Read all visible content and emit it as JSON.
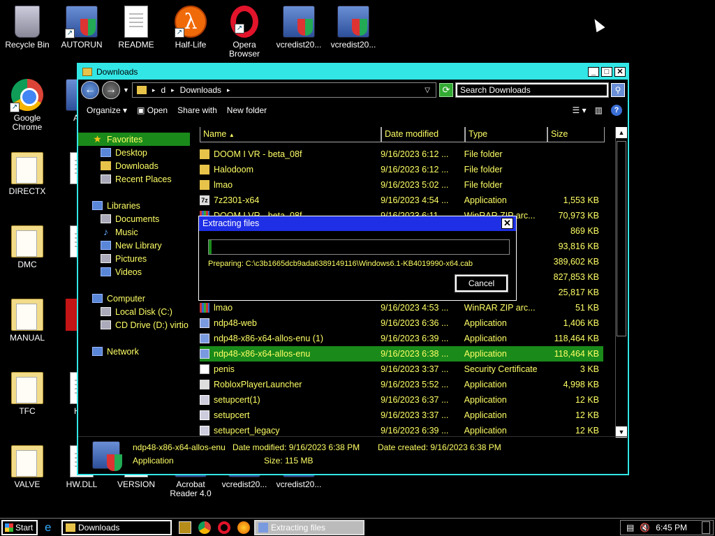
{
  "desktop": {
    "icons": [
      {
        "label": "Recycle Bin",
        "icon": "recycle-bin-icon"
      },
      {
        "label": "AUTORUN",
        "icon": "autorun-installer-icon"
      },
      {
        "label": "README",
        "icon": "text-file-icon"
      },
      {
        "label": "Half-Life",
        "icon": "half-life-icon"
      },
      {
        "label": "Opera Browser",
        "icon": "opera-icon"
      },
      {
        "label": "vcredist20...",
        "icon": "vcredist-installer-icon"
      },
      {
        "label": "vcredist20...",
        "icon": "vcredist-installer-icon"
      },
      {
        "label": "Google Chrome",
        "icon": "chrome-icon"
      },
      {
        "label": "AUT",
        "icon": "installer-icon"
      },
      {
        "label": "DIRECTX",
        "icon": "folder-icon"
      },
      {
        "label": "E",
        "icon": "file-icon"
      },
      {
        "label": "DMC",
        "icon": "folder-icon"
      },
      {
        "label": "HL",
        "icon": "file-icon"
      },
      {
        "label": "MANUAL",
        "icon": "folder-icon"
      },
      {
        "label": "TFC",
        "icon": "folder-icon"
      },
      {
        "label": "HL_",
        "icon": "file-icon"
      },
      {
        "label": "VALVE",
        "icon": "folder-icon"
      },
      {
        "label": "HW.DLL",
        "icon": "file-icon"
      },
      {
        "label": "VERSION",
        "icon": "text-file-icon"
      },
      {
        "label": "Acrobat Reader 4.0",
        "icon": "acrobat-icon"
      },
      {
        "label": "vcredist20...",
        "icon": "vcredist-installer-icon"
      },
      {
        "label": "vcredist20...",
        "icon": "vcredist-installer-icon"
      }
    ]
  },
  "explorer": {
    "title": "Downloads",
    "breadcrumb": [
      "d",
      "Downloads"
    ],
    "search_placeholder": "Search Downloads",
    "toolbar": {
      "organize": "Organize",
      "open": "Open",
      "share_with": "Share with",
      "new_folder": "New folder"
    },
    "nav": {
      "favorites": "Favorites",
      "desktop": "Desktop",
      "downloads": "Downloads",
      "recent": "Recent Places",
      "libraries": "Libraries",
      "documents": "Documents",
      "music": "Music",
      "new_library": "New Library",
      "pictures": "Pictures",
      "videos": "Videos",
      "computer": "Computer",
      "local_disk": "Local Disk (C:)",
      "cd_drive": "CD Drive (D:) virtio",
      "network": "Network"
    },
    "columns": {
      "name": "Name",
      "date": "Date modified",
      "type": "Type",
      "size": "Size"
    },
    "files": [
      {
        "name": "DOOM I VR - beta_08f",
        "date": "9/16/2023 6:12 ...",
        "type": "File folder",
        "size": ""
      },
      {
        "name": "Halodoom",
        "date": "9/16/2023 6:12 ...",
        "type": "File folder",
        "size": ""
      },
      {
        "name": "lmao",
        "date": "9/16/2023 5:02 ...",
        "type": "File folder",
        "size": ""
      },
      {
        "name": "7z2301-x64",
        "date": "9/16/2023 4:54 ...",
        "type": "Application",
        "size": "1,553 KB"
      },
      {
        "name": "DOOM I VR - beta_08f",
        "date": "9/16/2023 6:11 ...",
        "type": "WinRAR ZIP arc...",
        "size": "70,973 KB"
      },
      {
        "name": "",
        "date": "",
        "type": "",
        "size": "869 KB"
      },
      {
        "name": "",
        "date": "",
        "type": "Installe...",
        "size": "93,816 KB"
      },
      {
        "name": "",
        "date": "",
        "type": "hive",
        "size": "389,602 KB"
      },
      {
        "name": "",
        "date": "",
        "type": "arc...",
        "size": "827,853 KB"
      },
      {
        "name": "",
        "date": "",
        "type": "",
        "size": "25,817 KB"
      },
      {
        "name": "lmao",
        "date": "9/16/2023 4:53 ...",
        "type": "WinRAR ZIP arc...",
        "size": "51 KB"
      },
      {
        "name": "ndp48-web",
        "date": "9/16/2023 6:36 ...",
        "type": "Application",
        "size": "1,406 KB"
      },
      {
        "name": "ndp48-x86-x64-allos-enu (1)",
        "date": "9/16/2023 6:39 ...",
        "type": "Application",
        "size": "118,464 KB"
      },
      {
        "name": "ndp48-x86-x64-allos-enu",
        "date": "9/16/2023 6:38 ...",
        "type": "Application",
        "size": "118,464 KB"
      },
      {
        "name": "penis",
        "date": "9/16/2023 3:37 ...",
        "type": "Security Certificate",
        "size": "3 KB"
      },
      {
        "name": "RobloxPlayerLauncher",
        "date": "9/16/2023 5:52 ...",
        "type": "Application",
        "size": "4,998 KB"
      },
      {
        "name": "setupcert(1)",
        "date": "9/16/2023 6:37 ...",
        "type": "Application",
        "size": "12 KB"
      },
      {
        "name": "setupcert",
        "date": "9/16/2023 3:37 ...",
        "type": "Application",
        "size": "12 KB"
      },
      {
        "name": "setupcert_legacy",
        "date": "9/16/2023 6:39 ...",
        "type": "Application",
        "size": "12 KB"
      }
    ],
    "details": {
      "name": "ndp48-x86-x64-allos-enu",
      "modified": "Date modified: 9/16/2023 6:38 PM",
      "created": "Date created: 9/16/2023 6:38 PM",
      "type": "Application",
      "size": "Size: 115 MB"
    }
  },
  "dialog": {
    "title": "Extracting files",
    "progress": 0.01,
    "status": "Preparing: C:\\c3b1665dcb9ada6389149116\\Windows6.1-KB4019990-x64.cab",
    "cancel": "Cancel",
    "close": "✕"
  },
  "taskbar": {
    "start": "Start",
    "tasks": [
      "Downloads",
      "Extracting files"
    ],
    "time": "6:45 PM"
  },
  "colors": {
    "accent": "#33e6e6",
    "selection": "#1a8a1a",
    "dialog_title": "#1f2fe6",
    "text": "#ffff66"
  }
}
